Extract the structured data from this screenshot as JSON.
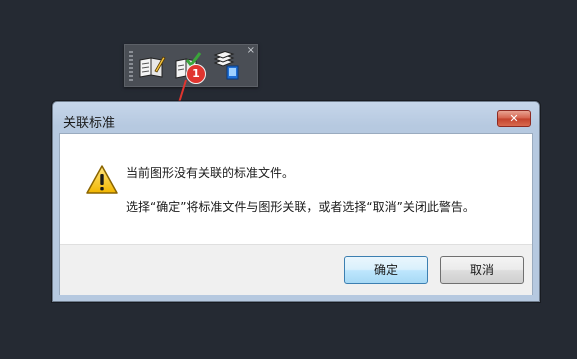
{
  "toolbar": {
    "buttons": [
      {
        "icon": "configure-standards-icon"
      },
      {
        "icon": "check-standards-icon"
      },
      {
        "icon": "layer-translator-icon"
      }
    ],
    "close_glyph": "×",
    "badge_number": "1"
  },
  "dialog": {
    "title": "关联标准",
    "close_glyph": "✕",
    "icon": "warning-icon",
    "message_line1": "当前图形没有关联的标准文件。",
    "message_line2": "选择“确定”将标准文件与图形关联，或者选择“取消”关闭此警告。",
    "ok_label": "确定",
    "cancel_label": "取消"
  },
  "colors": {
    "background": "#252a33",
    "toolbar": "#4a4e55",
    "badge": "#e0352f",
    "titlebar": "#b6c9e0",
    "close_button": "#c2412c"
  }
}
